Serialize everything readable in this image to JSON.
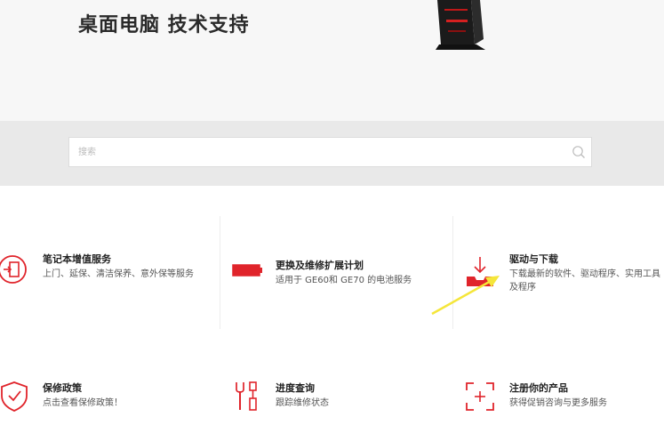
{
  "hero": {
    "title": "桌面电脑 技术支持"
  },
  "search": {
    "placeholder": "搜索"
  },
  "services": [
    {
      "title": "笔记本增值服务",
      "desc": "上门、延保、清洁保养、意外保等服务",
      "icon": "door-exit-icon"
    },
    {
      "title": "更换及维修扩展计划",
      "desc": "适用于 GE60和 GE70 的电池服务",
      "icon": "battery-icon"
    },
    {
      "title": "驱动与下载",
      "desc": "下载最新的软件、驱动程序、实用工具及程序",
      "icon": "download-tray-icon"
    },
    {
      "title": "保修政策",
      "desc": "点击查看保修政策！",
      "icon": "shield-check-icon"
    },
    {
      "title": "进度查询",
      "desc": "跟踪维修状态",
      "icon": "tools-icon"
    },
    {
      "title": "注册你的产品",
      "desc": "获得促销咨询与更多服务",
      "icon": "register-plus-icon"
    }
  ],
  "colors": {
    "accent": "#e0242b",
    "annotation": "#f5e63a",
    "band": "#e9e9e9"
  }
}
